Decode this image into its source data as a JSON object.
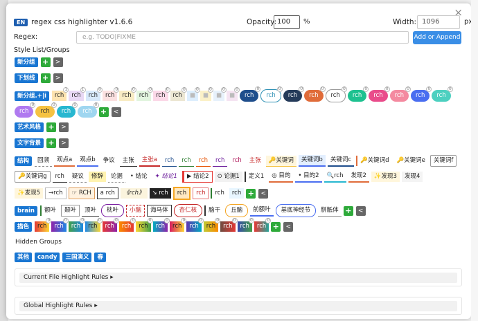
{
  "header": {
    "lang_badge": "EN",
    "version": "regex css highlighter v1.6.6",
    "opacity_label": "Opacity:",
    "opacity_value": "100",
    "opacity_unit": "%",
    "width_label": "Width:",
    "width_value": "1096",
    "width_unit": "px",
    "close": "×"
  },
  "regex": {
    "label": "Regex:",
    "placeholder": "e.g. TODO|FIXME",
    "button": "Add or Append"
  },
  "style_list_title": "Style List/Groups",
  "groups": {
    "g1": "新分组",
    "g2": "下划线",
    "g3": "新分组.+|i",
    "g4": "艺术风格",
    "g5": "文字背景",
    "g6": "结构",
    "g7": "brain",
    "g8": "描色"
  },
  "rch": "rch",
  "row3_colors": [
    "#1f4e8c",
    "#2b8fb3",
    "#253b5a",
    "#e06c3a",
    "#ffffff",
    "#1ec190",
    "#e94c8b",
    "#f48aa0",
    "#4a6ef0",
    "#4dd0c0"
  ],
  "row3b_colors": [
    "#b07af0",
    "#f5c242",
    "#27b7d0",
    "#9fd6f0"
  ],
  "struct_row1": [
    "回溯",
    "观点a",
    "观点b",
    "争议",
    "主张",
    "主张a",
    "rch",
    "rch",
    "rch",
    "rch",
    "rch",
    "主张",
    "关键词",
    "关键词b",
    "关键词c",
    "关键词d",
    "关键词e",
    "关键词f"
  ],
  "struct_row2": [
    "关键词g",
    "rch",
    "疑议",
    "修辞",
    "论据",
    "结论",
    "结论1",
    "结论2",
    "论据1",
    "定义1",
    "目的",
    "目的2",
    "rch",
    "发现2",
    "发现3",
    "发现4"
  ],
  "struct_row3": [
    "发现5",
    "rch",
    "RCH",
    "rch",
    "《rch》",
    "rch",
    "rch",
    "rch",
    "rch",
    "rch"
  ],
  "brain_row": [
    "额叶",
    "颞叶",
    "顶叶",
    "枕叶",
    "小脑",
    "海马体",
    "杏仁核",
    "脑干",
    "丘脑",
    "前额叶",
    "基底神经节",
    "胼胝体"
  ],
  "paint_colors": [
    "#e53935",
    "#8e24aa",
    "#1e88e5",
    "#43a047",
    "#fdd835",
    "#fb8c00",
    "#00acc1",
    "#d81b60",
    "#5e35b1",
    "#c0ca33",
    "#6d4c41",
    "#3949ab",
    "#e53935",
    "#26a69a"
  ],
  "hidden": {
    "title": "Hidden Groups",
    "items": [
      "其他",
      "candy",
      "三国演义",
      "春"
    ]
  },
  "accordion": {
    "current": "Current File Highlight Rules ▸",
    "global": "Global Highlight Rules ▸"
  }
}
